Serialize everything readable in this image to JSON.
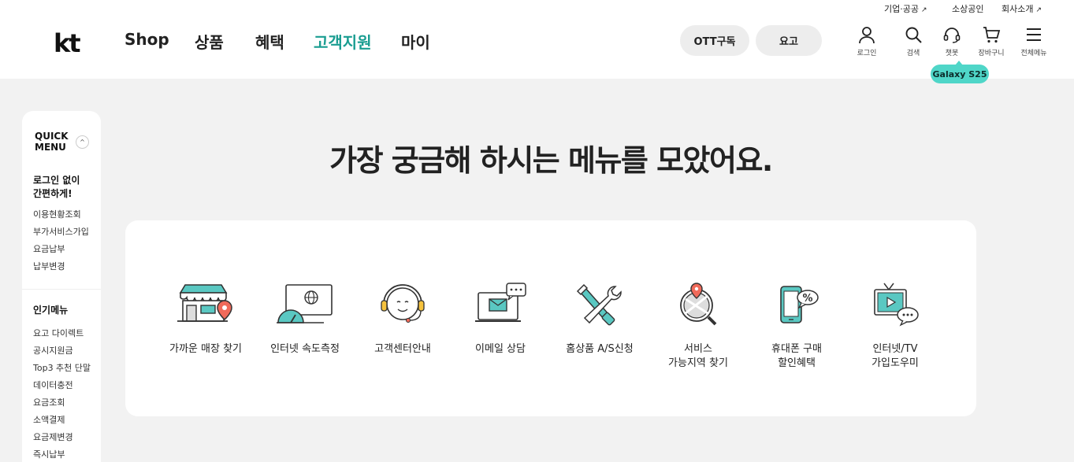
{
  "header": {
    "logo": "kt",
    "util_links": [
      {
        "label": "기업·공공",
        "external": true
      },
      {
        "label": "소상공인",
        "external": false
      },
      {
        "label": "회사소개",
        "external": true
      }
    ],
    "external_icon": "↗",
    "nav": [
      {
        "label": "Shop",
        "active": false
      },
      {
        "label": "상품",
        "active": false
      },
      {
        "label": "혜택",
        "active": false
      },
      {
        "label": "고객지원",
        "active": true
      },
      {
        "label": "마이",
        "active": false
      }
    ],
    "pills": [
      {
        "label": "OTT구독"
      },
      {
        "label": "요고"
      }
    ],
    "icons": [
      {
        "label": "로그인",
        "icon": "user-icon"
      },
      {
        "label": "검색",
        "icon": "search-icon"
      },
      {
        "label": "챗봇",
        "icon": "headset-icon"
      },
      {
        "label": "장바구니",
        "icon": "cart-icon"
      },
      {
        "label": "전체메뉴",
        "icon": "hamburger-icon"
      }
    ],
    "bubble": "Galaxy S25",
    "accent_color": "#1a9d91",
    "bubble_color": "#4fd6c8"
  },
  "quick_menu": {
    "title_line1": "QUICK",
    "title_line2": "MENU",
    "toggle": "^",
    "group1_title_line1": "로그인 없이",
    "group1_title_line2": "간편하게!",
    "group1_items": [
      "이용현황조회",
      "부가서비스가입",
      "요금납부",
      "납부변경"
    ],
    "group2_title": "인기메뉴",
    "group2_items": [
      "요고 다이렉트",
      "공시지원금",
      "Top3 추천 단말",
      "데이터충전",
      "요금조회",
      "소액결제",
      "요금제변경",
      "즉시납부"
    ]
  },
  "main": {
    "headline": "가장 궁금해 하시는 메뉴를 모았어요.",
    "services": [
      {
        "label": "가까운 매장 찾기",
        "icon": "store-location-icon"
      },
      {
        "label": "인터넷 속도측정",
        "icon": "speed-test-icon"
      },
      {
        "label": "고객센터안내",
        "icon": "customer-center-icon"
      },
      {
        "label": "이메일 상담",
        "icon": "email-consult-icon"
      },
      {
        "label": "홈상품 A/S신청",
        "icon": "repair-tools-icon"
      },
      {
        "label": "서비스\n가능지역 찾기",
        "icon": "service-area-search-icon"
      },
      {
        "label": "휴대폰 구매\n할인혜택",
        "icon": "phone-discount-icon"
      },
      {
        "label": "인터넷/TV\n가입도우미",
        "icon": "tv-join-helper-icon"
      }
    ]
  }
}
